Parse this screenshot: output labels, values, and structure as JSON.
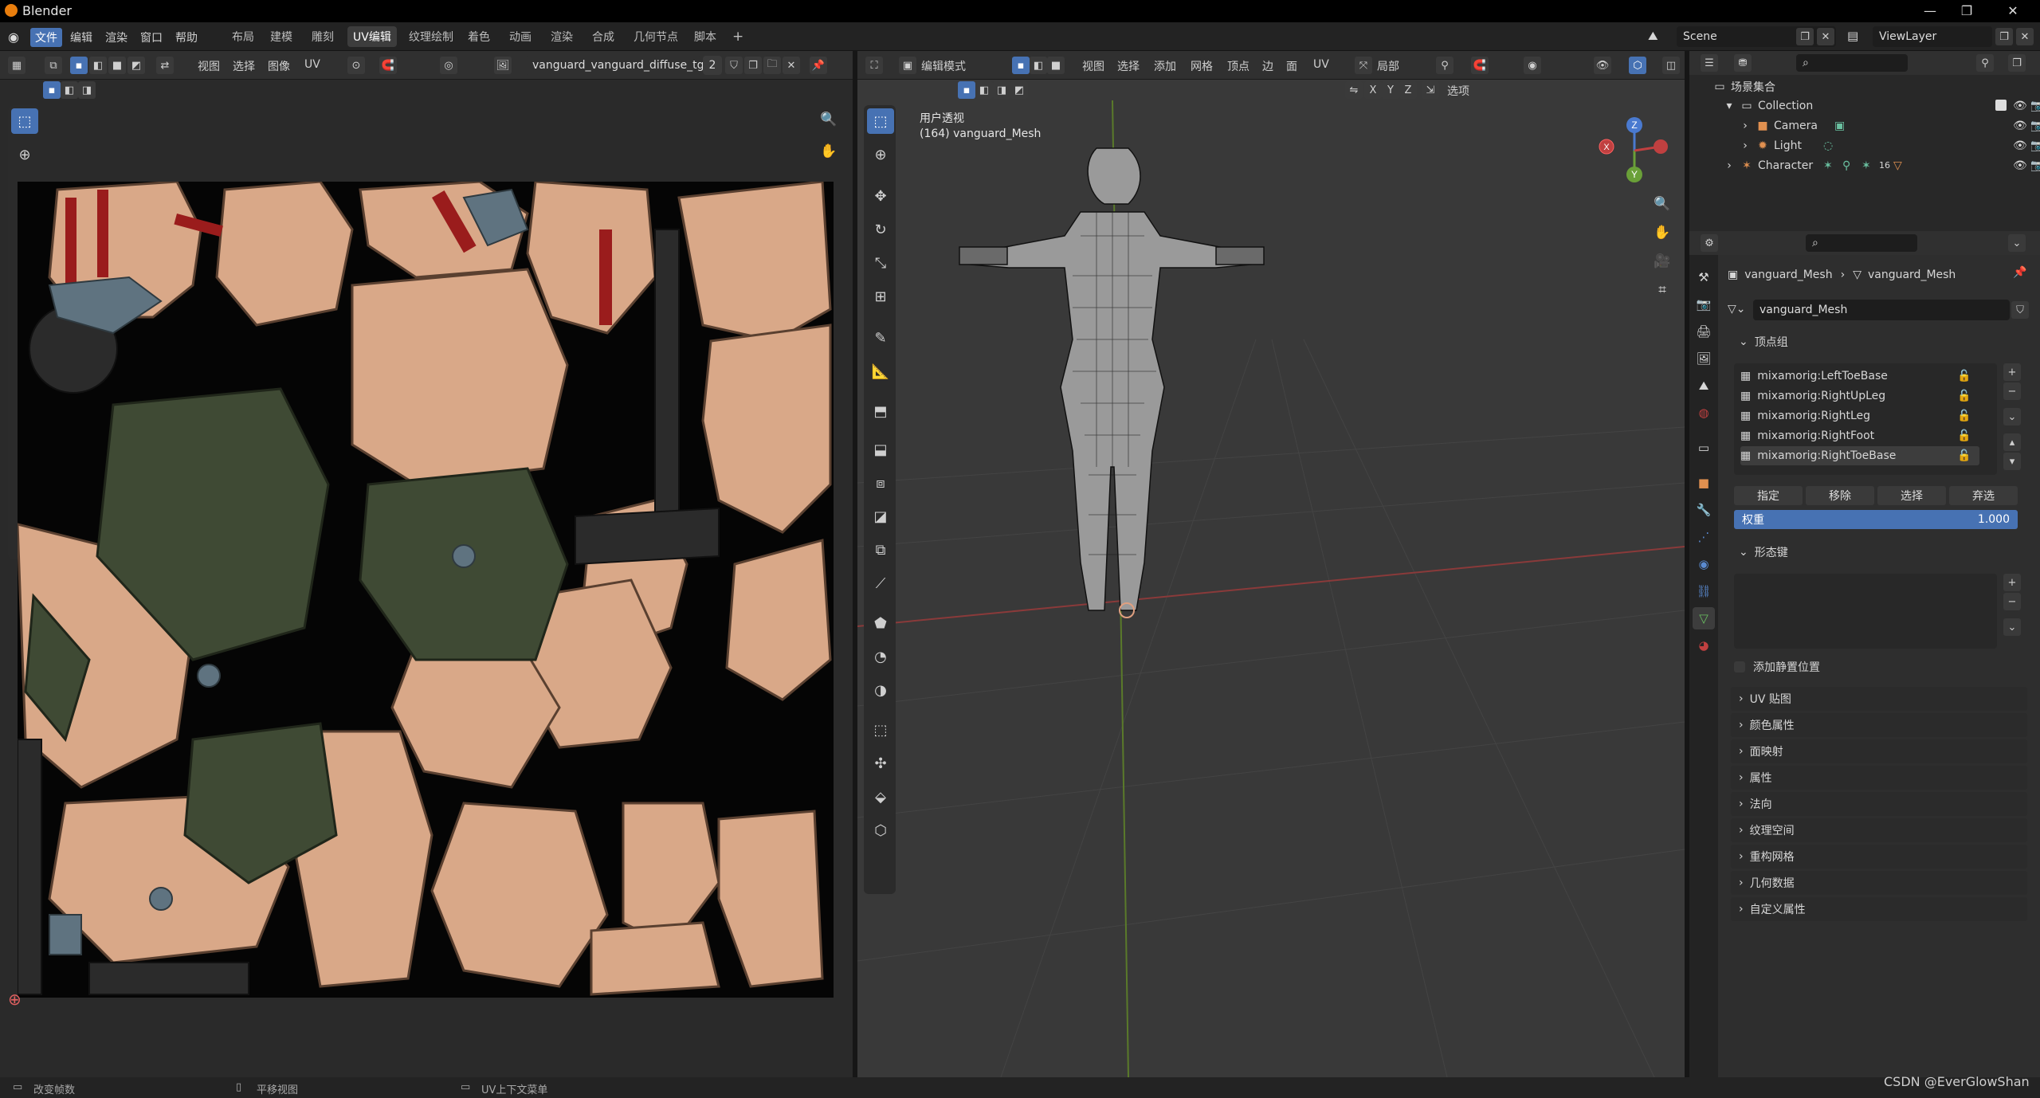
{
  "app": {
    "title": "Blender"
  },
  "topbar": {
    "menus": [
      "文件",
      "编辑",
      "渲染",
      "窗口",
      "帮助"
    ],
    "workspaces": [
      "布局",
      "建模",
      "雕刻",
      "UV编辑",
      "纹理绘制",
      "着色",
      "动画",
      "渲染",
      "合成",
      "几何节点",
      "脚本"
    ],
    "active_workspace": "UV编辑",
    "add_tab": "+",
    "scene": "Scene",
    "viewlayer": "ViewLayer"
  },
  "uv_editor": {
    "menus": [
      "视图",
      "选择",
      "图像",
      "UV"
    ],
    "image_name": "vanguard_vanguard_diffuse_tga",
    "user_count": "2"
  },
  "viewport": {
    "mode": "编辑模式",
    "menus": [
      "视图",
      "选择",
      "添加",
      "网格",
      "顶点",
      "边",
      "面",
      "UV"
    ],
    "transform_orientation": "局部",
    "axes": [
      "X",
      "Y",
      "Z"
    ],
    "options": "选项",
    "view_name": "用户透视",
    "object_info": "(164) vanguard_Mesh",
    "gizmo": {
      "x": "X",
      "y": "Y",
      "z": "Z"
    }
  },
  "outliner": {
    "root": "场景集合",
    "items": [
      {
        "label": "Collection",
        "depth": 1
      },
      {
        "label": "Camera",
        "depth": 2
      },
      {
        "label": "Light",
        "depth": 2
      },
      {
        "label": "Character",
        "depth": 1
      }
    ],
    "character_count": "16"
  },
  "properties": {
    "breadcrumb_object": "vanguard_Mesh",
    "breadcrumb_data": "vanguard_Mesh",
    "mesh_name": "vanguard_Mesh",
    "vertex_groups_title": "顶点组",
    "vertex_groups": [
      "mixamorig:LeftToeBase",
      "mixamorig:RightUpLeg",
      "mixamorig:RightLeg",
      "mixamorig:RightFoot",
      "mixamorig:RightToeBase"
    ],
    "vg_buttons": [
      "指定",
      "移除",
      "选择",
      "弃选"
    ],
    "weight_label": "权重",
    "weight_value": "1.000",
    "shape_keys_title": "形态键",
    "add_rest_position": "添加静置位置",
    "sections": [
      "UV 贴图",
      "颜色属性",
      "面映射",
      "属性",
      "法向",
      "纹理空间",
      "重构网格",
      "几何数据",
      "自定义属性"
    ]
  },
  "statusbar": {
    "items": [
      "改变帧数",
      "平移视图",
      "UV上下文菜单"
    ],
    "watermark": "CSDN @EverGlowShan"
  },
  "colors": {
    "accent": "#4772b3",
    "bg": "#1d1d1d",
    "panel": "#303030",
    "texture_skin": "#d9a888",
    "texture_green": "#3f4a34",
    "texture_red": "#9a1c1c"
  }
}
